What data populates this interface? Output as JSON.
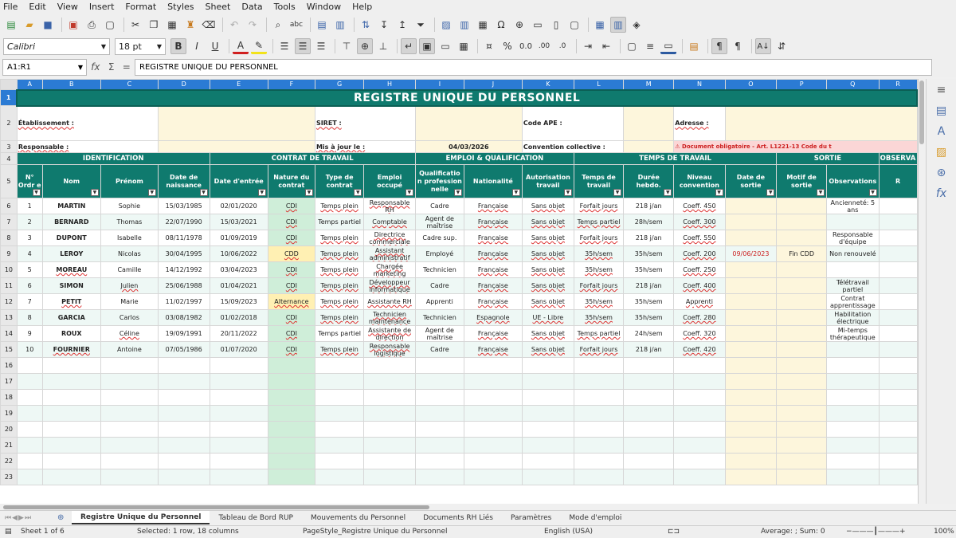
{
  "menu": [
    "File",
    "Edit",
    "View",
    "Insert",
    "Format",
    "Styles",
    "Sheet",
    "Data",
    "Tools",
    "Window",
    "Help"
  ],
  "font": {
    "name": "Calibri",
    "size": "18 pt"
  },
  "namebox": "A1:R1",
  "formula": "REGISTRE UNIQUE DU PERSONNEL",
  "columns": [
    "A",
    "B",
    "C",
    "D",
    "E",
    "F",
    "G",
    "H",
    "I",
    "J",
    "K",
    "L",
    "M",
    "N",
    "O",
    "P",
    "Q",
    "R"
  ],
  "row_numbers": [
    "1",
    "2",
    "3",
    "4",
    "5",
    "6",
    "7",
    "8",
    "9",
    "10",
    "11",
    "12",
    "13",
    "14",
    "15",
    "16",
    "17",
    "18",
    "19",
    "20",
    "21",
    "22",
    "23"
  ],
  "title": "REGISTRE UNIQUE DU PERSONNEL",
  "info": {
    "etablissement": "Établissement :",
    "siret": "SIRET :",
    "code_ape": "Code APE :",
    "adresse": "Adresse :",
    "responsable": "Responsable :",
    "mis_a_jour": "Mis à jour le :",
    "date": "04/03/2026",
    "convention": "Convention collective :",
    "warning": "⚠ Document obligatoire - Art. L1221-13 Code du t"
  },
  "sections": [
    "IDENTIFICATION",
    "CONTRAT DE TRAVAIL",
    "EMPLOI & QUALIFICATION",
    "TEMPS DE TRAVAIL",
    "SORTIE",
    "OBSERVA"
  ],
  "headers": [
    "N° Ordr e",
    "Nom",
    "Prénom",
    "Date de naissance",
    "Date d'entrée",
    "Nature du contrat",
    "Type de contrat",
    "Emploi occupé",
    "Qualificatio n profession nelle",
    "Nationalité",
    "Autorisation travail",
    "Temps de travail",
    "Durée hebdo.",
    "Niveau convention",
    "Date de sortie",
    "Motif de sortie",
    "Observations",
    "R"
  ],
  "rows": [
    [
      "1",
      "MARTIN",
      "Sophie",
      "15/03/1985",
      "02/01/2020",
      "CDI",
      "Temps plein",
      "Responsable RH",
      "Cadre",
      "Française",
      "Sans objet",
      "Forfait jours",
      "218 j/an",
      "Coeff. 450",
      "",
      "",
      "Ancienneté: 5 ans"
    ],
    [
      "2",
      "BERNARD",
      "Thomas",
      "22/07/1990",
      "15/03/2021",
      "CDI",
      "Temps partiel",
      "Comptable",
      "Agent de maîtrise",
      "Française",
      "Sans objet",
      "Temps partiel",
      "28h/sem",
      "Coeff. 300",
      "",
      "",
      ""
    ],
    [
      "3",
      "DUPONT",
      "Isabelle",
      "08/11/1978",
      "01/09/2019",
      "CDI",
      "Temps plein",
      "Directrice commerciale",
      "Cadre sup.",
      "Française",
      "Sans objet",
      "Forfait jours",
      "218 j/an",
      "Coeff. 550",
      "",
      "",
      "Responsable d'équipe"
    ],
    [
      "4",
      "LEROY",
      "Nicolas",
      "30/04/1995",
      "10/06/2022",
      "CDD",
      "Temps plein",
      "Assistant administratif",
      "Employé",
      "Française",
      "Sans objet",
      "35h/sem",
      "35h/sem",
      "Coeff. 200",
      "09/06/2023",
      "Fin CDD",
      "Non renouvelé"
    ],
    [
      "5",
      "MOREAU",
      "Camille",
      "14/12/1992",
      "03/04/2023",
      "CDI",
      "Temps plein",
      "Chargée marketing",
      "Technicien",
      "Française",
      "Sans objet",
      "35h/sem",
      "35h/sem",
      "Coeff. 250",
      "",
      "",
      ""
    ],
    [
      "6",
      "SIMON",
      "Julien",
      "25/06/1988",
      "01/04/2021",
      "CDI",
      "Temps plein",
      "Développeur informatique",
      "Cadre",
      "Française",
      "Sans objet",
      "Forfait jours",
      "218 j/an",
      "Coeff. 400",
      "",
      "",
      "Télétravail partiel"
    ],
    [
      "7",
      "PETIT",
      "Marie",
      "11/02/1997",
      "15/09/2023",
      "Alternance",
      "Temps plein",
      "Assistante RH",
      "Apprenti",
      "Française",
      "Sans objet",
      "35h/sem",
      "35h/sem",
      "Apprenti",
      "",
      "",
      "Contrat apprentissage"
    ],
    [
      "8",
      "GARCIA",
      "Carlos",
      "03/08/1982",
      "01/02/2018",
      "CDI",
      "Temps plein",
      "Technicien maintenance",
      "Technicien",
      "Espagnole",
      "UE - Libre",
      "35h/sem",
      "35h/sem",
      "Coeff. 280",
      "",
      "",
      "Habilitation électrique"
    ],
    [
      "9",
      "ROUX",
      "Céline",
      "19/09/1991",
      "20/11/2022",
      "CDI",
      "Temps partiel",
      "Assistante de direction",
      "Agent de maîtrise",
      "Française",
      "Sans objet",
      "Temps partiel",
      "24h/sem",
      "Coeff. 320",
      "",
      "",
      "Mi-temps thérapeutique"
    ],
    [
      "10",
      "FOURNIER",
      "Antoine",
      "07/05/1986",
      "01/07/2020",
      "CDI",
      "Temps plein",
      "Responsable logistique",
      "Cadre",
      "Française",
      "Sans objet",
      "Forfait jours",
      "218 j/an",
      "Coeff. 420",
      "",
      "",
      ""
    ]
  ],
  "tabs": [
    "Registre Unique du Personnel",
    "Tableau de Bord RUP",
    "Mouvements du Personnel",
    "Documents RH Liés",
    "Paramètres",
    "Mode d'emploi"
  ],
  "status": {
    "sheet": "Sheet 1 of 6",
    "selection": "Selected: 1 row, 18 columns",
    "pagestyle": "PageStyle_Registre Unique du Personnel",
    "language": "English (USA)",
    "summary": "Average: ; Sum: 0",
    "zoom": "100%"
  },
  "colors": {
    "header_teal": "#0f7a6e",
    "selection_blue": "#2b7bd4",
    "warning_red": "#cc1f1f"
  }
}
